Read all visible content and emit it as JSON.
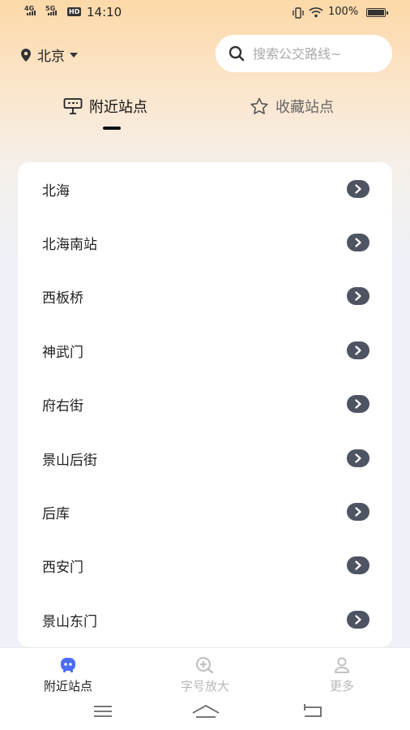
{
  "status_bar": {
    "net1": "4G",
    "net2": "5G",
    "hd": "HD",
    "time": "14:10",
    "battery_percent": "100%",
    "battery_level": 1.0
  },
  "header": {
    "city": "北京",
    "search_placeholder": "搜索公交路线~"
  },
  "tabs": [
    {
      "label": "附近站点",
      "active": true
    },
    {
      "label": "收藏站点",
      "active": false
    }
  ],
  "stations": [
    {
      "name": "北海"
    },
    {
      "name": "北海南站"
    },
    {
      "name": "西板桥"
    },
    {
      "name": "神武门"
    },
    {
      "name": "府右街"
    },
    {
      "name": "景山后街"
    },
    {
      "name": "后库"
    },
    {
      "name": "西安门"
    },
    {
      "name": "景山东门"
    }
  ],
  "bottom_nav": [
    {
      "label": "附近站点",
      "icon": "bus-face-icon",
      "active": true
    },
    {
      "label": "字号放大",
      "icon": "zoom-plus-icon",
      "active": false
    },
    {
      "label": "更多",
      "icon": "user-icon",
      "active": false
    }
  ],
  "colors": {
    "header_gradient_top": "#fcd9a8",
    "background": "#eef1f7",
    "arrow_badge": "#4e5461",
    "active_nav": "#4a6cf7",
    "inactive_text": "#b8b8b8"
  }
}
